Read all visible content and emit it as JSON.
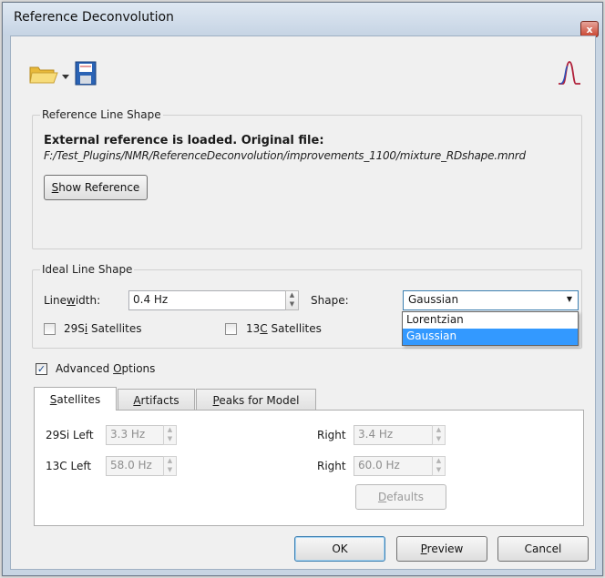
{
  "window": {
    "title": "Reference Deconvolution",
    "close_glyph": "x"
  },
  "toolbar": {
    "open_icon": "folder-open-icon",
    "save_icon": "floppy-disk-icon",
    "peak_icon": "peak-shape-icon"
  },
  "reference": {
    "group_title": "Reference Line Shape",
    "status": "External reference is loaded. Original file:",
    "path": "F:/Test_Plugins/NMR/ReferenceDeconvolution/improvements_1100/mixture_RDshape.mnrd",
    "show_button": {
      "pre": "",
      "mnemonic": "S",
      "post": "how Reference"
    }
  },
  "ideal": {
    "group_title": "Ideal Line Shape",
    "linewidth_label": {
      "pre": "Line",
      "mnemonic": "w",
      "post": "idth:"
    },
    "linewidth_value": "0.4 Hz",
    "shape_label": "Shape:",
    "shape_value": "Gaussian",
    "shape_options": [
      "Lorentzian",
      "Gaussian"
    ],
    "si_satellites": {
      "pre": "29S",
      "mnemonic": "i",
      "post": " Satellites",
      "checked": false
    },
    "c_satellites": {
      "pre": "13",
      "mnemonic": "C",
      "post": " Satellites",
      "checked": false
    }
  },
  "advanced": {
    "checked": true,
    "label": {
      "pre": "Advanced ",
      "mnemonic": "O",
      "post": "ptions"
    },
    "tabs": [
      {
        "pre": "",
        "mnemonic": "S",
        "post": "atellites"
      },
      {
        "pre": "",
        "mnemonic": "A",
        "post": "rtifacts"
      },
      {
        "pre": "",
        "mnemonic": "P",
        "post": "eaks for Model"
      }
    ],
    "satellites": {
      "si_left_label": "29Si Left",
      "si_left_value": "3.3 Hz",
      "si_right_label": "Right",
      "si_right_value": "3.4 Hz",
      "c_left_label": "13C Left",
      "c_left_value": "58.0 Hz",
      "c_right_label": "Right",
      "c_right_value": "60.0 Hz",
      "defaults_button": {
        "pre": "",
        "mnemonic": "D",
        "post": "efaults"
      }
    }
  },
  "buttons": {
    "ok": "OK",
    "preview": {
      "pre": "",
      "mnemonic": "P",
      "post": "review"
    },
    "cancel": "Cancel"
  },
  "colors": {
    "accent": "#3399ff",
    "peak_icon": "#b0203a",
    "folder": "#f2c94c",
    "floppy": "#1e5aa8"
  }
}
